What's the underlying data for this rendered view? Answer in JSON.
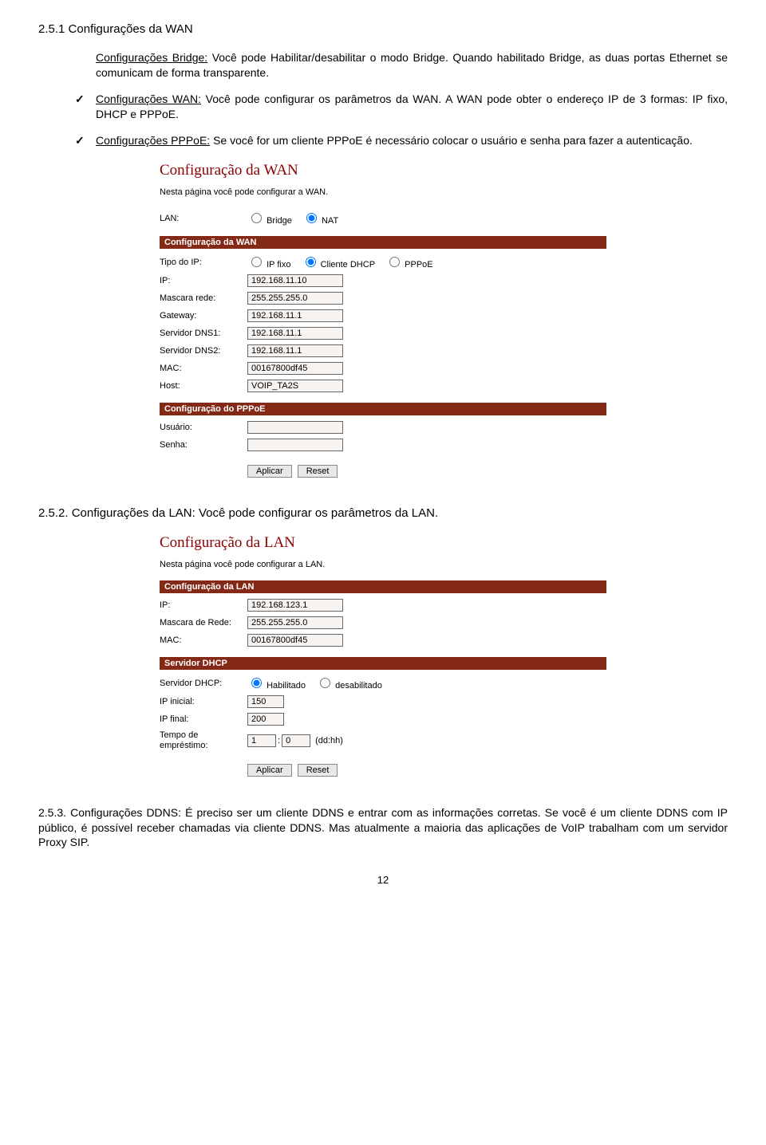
{
  "doc": {
    "sec251_title": "2.5.1  Configurações da WAN",
    "para1_strong": "Configurações Bridge:",
    "para1_rest": " Você pode Habilitar/desabilitar o modo Bridge. Quando habilitado Bridge, as duas portas Ethernet se comunicam de forma transparente.",
    "bullet1_strong": "Configurações WAN:",
    "bullet1_rest": " Você pode configurar os parâmetros da WAN. A WAN pode obter o endereço IP de 3 formas: IP fixo, DHCP e PPPoE.",
    "bullet2_strong": "Configurações PPPoE:",
    "bullet2_rest": " Se  você for um cliente PPPoE é necessário colocar o usuário e senha para fazer a autenticação.",
    "sec252": "2.5.2. Configurações da LAN: Você pode configurar os parâmetros da LAN.",
    "sec253": "2.5.3. Configurações DDNS: É preciso ser um cliente DDNS e entrar com as informações corretas. Se você é um cliente DDNS com IP público, é possível receber chamadas via cliente DDNS. Mas atualmente a maioria das aplicações de VoIP trabalham com um servidor Proxy SIP.",
    "page_num": "12"
  },
  "wan": {
    "title": "Configuração da WAN",
    "desc": "Nesta página você pode configurar a WAN.",
    "lan_label": "LAN:",
    "radio_bridge": "Bridge",
    "radio_nat": "NAT",
    "hdr1": "Configuração da WAN",
    "tipo_label": "Tipo do IP:",
    "radio_fixo": "IP fixo",
    "radio_dhcp": "Cliente DHCP",
    "radio_pppoe": "PPPoE",
    "ip_label": "IP:",
    "ip_val": "192.168.11.10",
    "mask_label": "Mascara rede:",
    "mask_val": "255.255.255.0",
    "gw_label": "Gateway:",
    "gw_val": "192.168.11.1",
    "dns1_label": "Servidor DNS1:",
    "dns1_val": "192.168.11.1",
    "dns2_label": "Servidor DNS2:",
    "dns2_val": "192.168.11.1",
    "mac_label": "MAC:",
    "mac_val": "00167800df45",
    "host_label": "Host:",
    "host_val": "VOIP_TA2S",
    "hdr2": "Configuração do PPPoE",
    "user_label": "Usuário:",
    "pass_label": "Senha:",
    "btn_apply": "Aplicar",
    "btn_reset": "Reset"
  },
  "lan": {
    "title": "Configuração da LAN",
    "desc": "Nesta página você pode configurar a LAN.",
    "hdr1": "Configuração da LAN",
    "ip_label": "IP:",
    "ip_val": "192.168.123.1",
    "mask_label": "Mascara de Rede:",
    "mask_val": "255.255.255.0",
    "mac_label": "MAC:",
    "mac_val": "00167800df45",
    "hdr2": "Servidor DHCP",
    "srv_label": "Servidor DHCP:",
    "radio_on": "Habilitado",
    "radio_off": "desabilitado",
    "ipini_label": "IP inicial:",
    "ipini_val": "150",
    "ipfin_label": "IP final:",
    "ipfin_val": "200",
    "lease_label": "Tempo de empréstimo:",
    "lease_d": "1",
    "lease_h": "0",
    "lease_unit": "(dd:hh)",
    "btn_apply": "Aplicar",
    "btn_reset": "Reset"
  }
}
